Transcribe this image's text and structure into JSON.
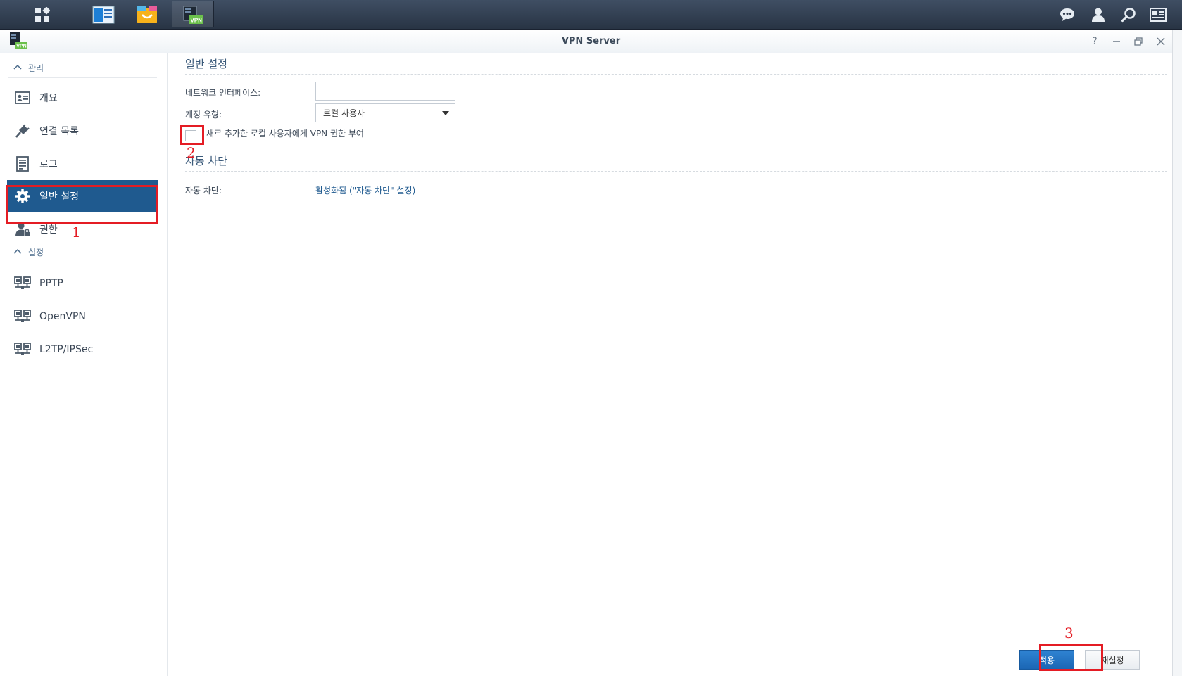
{
  "window": {
    "title": "VPN Server"
  },
  "sidebar": {
    "sections": [
      {
        "label": "관리"
      },
      {
        "label": "설정"
      }
    ],
    "items": [
      {
        "label": "개요"
      },
      {
        "label": "연결 목록"
      },
      {
        "label": "로그"
      },
      {
        "label": "일반 설정",
        "selected": true
      },
      {
        "label": "권한"
      },
      {
        "label": "PPTP"
      },
      {
        "label": "OpenVPN"
      },
      {
        "label": "L2TP/IPSec"
      }
    ]
  },
  "main": {
    "general_section_title": "일반 설정",
    "network_interface_label": "네트워크 인터페이스:",
    "network_interface_value": "",
    "account_type_label": "계정 유형:",
    "account_type_value": "로컬 사용자",
    "grant_vpn_checkbox_label": "새로 추가한 로컬 사용자에게 VPN 권한 부여",
    "grant_vpn_checked": false,
    "autoblock_section_title": "자동 차단",
    "autoblock_label": "자동 차단:",
    "autoblock_link": "활성화됨 (\"자동 차단\" 설정)"
  },
  "footer": {
    "apply_label": "적용",
    "reset_label": "재설정"
  },
  "annotations": {
    "one": "1",
    "two": "2",
    "three": "3"
  },
  "colors": {
    "accent": "#1f5a8f",
    "highlight": "#e41c24",
    "taskbar": "#2f3b4d"
  }
}
